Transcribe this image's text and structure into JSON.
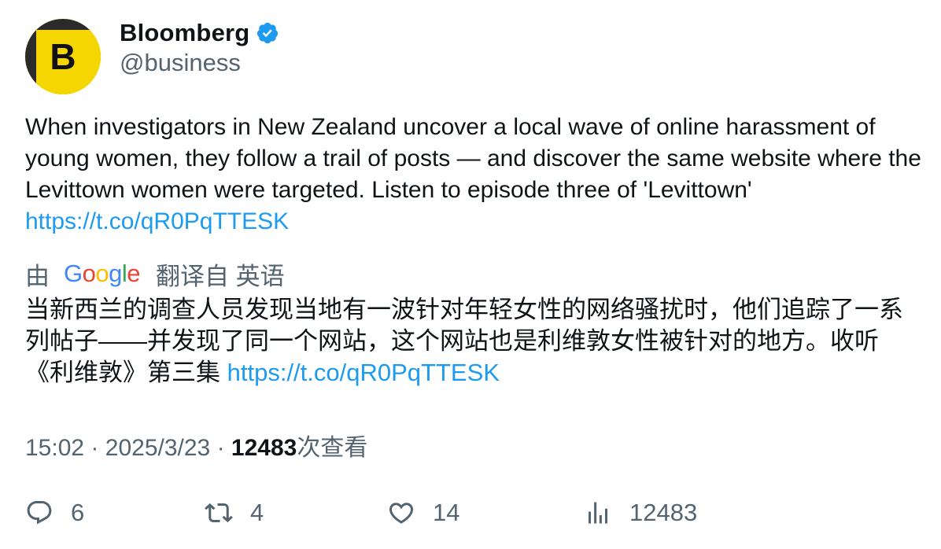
{
  "account": {
    "name": "Bloomberg",
    "handle": "@business",
    "avatar_letter": "B",
    "avatar_color": "#f5d600"
  },
  "tweet": {
    "text": "When investigators in New Zealand uncover a local wave of online harassment of young women, they follow a trail of posts — and discover the same website where the Levittown women were targeted. Listen to episode three of 'Levittown'",
    "link": "https://t.co/qR0PqTTESK"
  },
  "translation": {
    "prefix": "由",
    "provider": "Google",
    "suffix": "翻译自 英语",
    "text": "当新西兰的调查人员发现当地有一波针对年轻女性的网络骚扰时，他们追踪了一系列帖子——并发现了同一个网站，这个网站也是利维敦女性被针对的地方。收听《利维敦》第三集",
    "link": "https://t.co/qR0PqTTESK"
  },
  "meta": {
    "time": "15:02",
    "sep1": "·",
    "date": "2025/3/23",
    "sep2": "·",
    "views": "12483",
    "views_label": "次查看"
  },
  "actions": {
    "replies": "6",
    "retweets": "4",
    "likes": "14",
    "views": "12483"
  },
  "colors": {
    "link": "#1d9bf0",
    "secondary": "#536471",
    "verified": "#1d9bf0"
  }
}
